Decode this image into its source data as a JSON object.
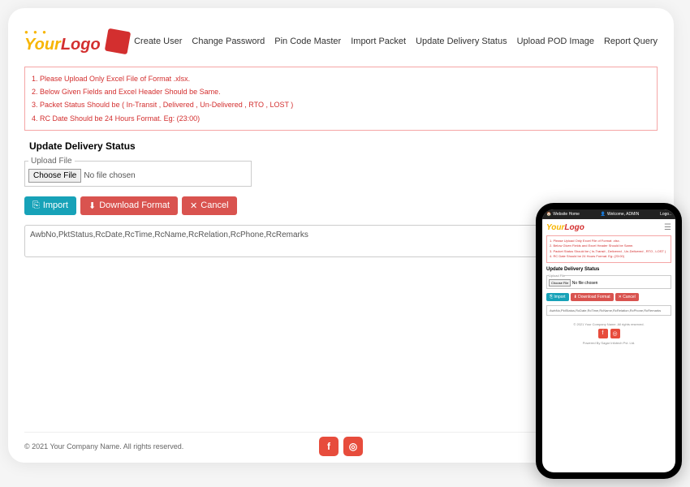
{
  "logo": {
    "text1": "Your",
    "text2": "Logo"
  },
  "nav": [
    "Create User",
    "Change Password",
    "Pin Code Master",
    "Import Packet",
    "Update Delivery Status",
    "Upload POD Image",
    "Report Query"
  ],
  "instructions": [
    "1. Please Upload Only Excel File of Format .xlsx.",
    "2. Below Given Fields and Excel Header Should be Same.",
    "3. Packet Status Should be ( In-Transit , Delivered , Un-Delivered , RTO , LOST )",
    "4. RC Date Should be 24 Hours Format. Eg: (23:00)"
  ],
  "section_title": "Update Delivery Status",
  "upload": {
    "legend": "Upload File",
    "button": "Choose File",
    "placeholder": "No file chosen"
  },
  "buttons": {
    "import": "Import",
    "download": "Download Format",
    "cancel": "Cancel"
  },
  "textarea": "AwbNo,PktStatus,RcDate,RcTime,RcName,RcRelation,RcPhone,RcRemarks",
  "footer": "© 2021 Your Company Name. All rights reserved.",
  "phone": {
    "top_left": "Website Home",
    "top_mid": "Welcome, ADMIN",
    "top_right": "Logo..",
    "footer1": "© 2021 Your Company Name. All rights reserved.",
    "footer2": "Powered By Sagar Infotech Pvt. Ltd."
  }
}
